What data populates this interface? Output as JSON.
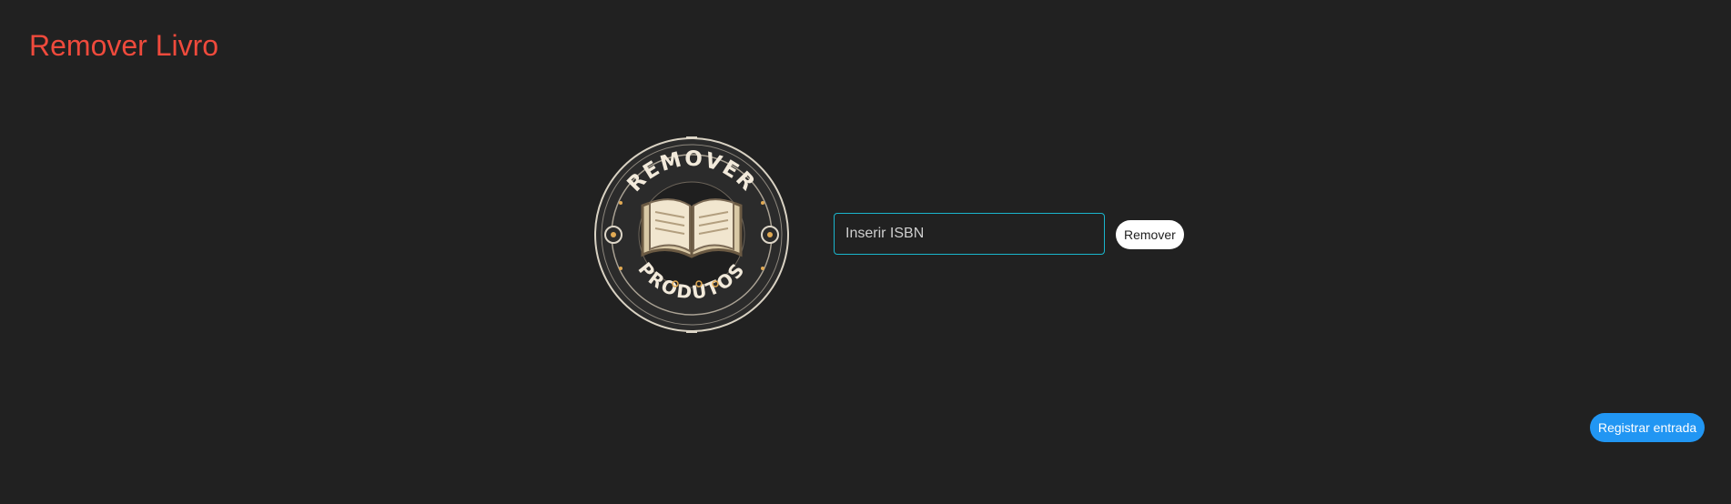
{
  "page": {
    "title": "Remover Livro"
  },
  "logo": {
    "icon": "book-emblem-icon",
    "top_text": "REMOVER",
    "bottom_text": "PRODUTOS"
  },
  "form": {
    "isbn_placeholder": "Inserir ISBN",
    "isbn_value": "",
    "remove_label": "Remover"
  },
  "actions": {
    "register_label": "Registrar entrada"
  },
  "colors": {
    "background": "#212121",
    "title": "#ef4a3c",
    "input_border": "#1ab5cc",
    "primary_button": "#2196f3"
  }
}
